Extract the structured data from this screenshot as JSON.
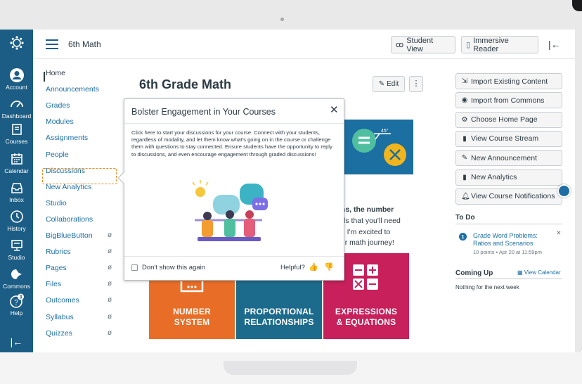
{
  "global_nav": {
    "items": [
      {
        "label": "Account",
        "icon": "account-icon"
      },
      {
        "label": "Dashboard",
        "icon": "dashboard-icon"
      },
      {
        "label": "Courses",
        "icon": "courses-icon"
      },
      {
        "label": "Calendar",
        "icon": "calendar-icon"
      },
      {
        "label": "Inbox",
        "icon": "inbox-icon"
      },
      {
        "label": "History",
        "icon": "history-icon"
      },
      {
        "label": "Studio",
        "icon": "studio-icon"
      },
      {
        "label": "Commons",
        "icon": "commons-icon"
      },
      {
        "label": "Help",
        "icon": "help-icon",
        "badge": "3"
      }
    ]
  },
  "header": {
    "course_name": "6th Math",
    "student_view": "Student View",
    "immersive_reader": "Immersive Reader"
  },
  "course_nav": {
    "items": [
      {
        "label": "Home",
        "active": true
      },
      {
        "label": "Announcements"
      },
      {
        "label": "Grades"
      },
      {
        "label": "Modules"
      },
      {
        "label": "Assignments"
      },
      {
        "label": "People"
      },
      {
        "label": "Discussions"
      },
      {
        "label": "New Analytics"
      },
      {
        "label": "Studio"
      },
      {
        "label": "Collaborations"
      },
      {
        "label": "BigBlueButton",
        "hidden": true
      },
      {
        "label": "Rubrics",
        "hidden": true
      },
      {
        "label": "Pages",
        "hidden": true
      },
      {
        "label": "Files",
        "hidden": true
      },
      {
        "label": "Outcomes",
        "hidden": true
      },
      {
        "label": "Syllabus",
        "hidden": true
      },
      {
        "label": "Quizzes",
        "hidden": true
      }
    ]
  },
  "main": {
    "title": "6th Grade Math",
    "edit": "Edit",
    "body_lines": [
      "rtions, the number",
      "t skills that you'll need",
      "hool.  I'm excited to",
      "f your math journey!"
    ],
    "tiles": [
      {
        "line1": "NUMBER",
        "line2": "SYSTEM",
        "color": "#e86d27"
      },
      {
        "line1": "PROPORTIONAL",
        "line2": "RELATIONSHIPS",
        "color": "#1c6a8c"
      },
      {
        "line1": "EXPRESSIONS",
        "line2": "& EQUATIONS",
        "color": "#c7205a"
      }
    ]
  },
  "popover": {
    "title": "Bolster Engagement in Your Courses",
    "body": "Click here to start your discussions for your course. Connect with your students, regardless of modality, and let them know what's going on in the course or challenge them with questions to stay connected. Ensure students have the opportunity to reply to discussions, and even encourage engagement through graded discussions!",
    "dont_show": "Don't show this again",
    "helpful": "Helpful?"
  },
  "sidebar": {
    "buttons": [
      {
        "label": "Import Existing Content",
        "icon": "import-icon"
      },
      {
        "label": "Import from Commons",
        "icon": "commons-icon"
      },
      {
        "label": "Choose Home Page",
        "icon": "home-page-icon"
      },
      {
        "label": "View Course Stream",
        "icon": "stream-icon"
      },
      {
        "label": "New Announcement",
        "icon": "announcement-icon"
      },
      {
        "label": "New Analytics",
        "icon": "analytics-icon"
      },
      {
        "label": "View Course Notifications",
        "icon": "bell-icon"
      }
    ],
    "todo": {
      "heading": "To Do",
      "item_title_1": "Grade Word Problems:",
      "item_title_2": "Ratios and Scenarios",
      "item_meta": "10 points • Apr 20 at 11:59pm",
      "count": "1"
    },
    "coming_up": {
      "heading": "Coming Up",
      "view_calendar": "View Calendar",
      "empty": "Nothing for the next week"
    }
  },
  "colors": {
    "nav_bg": "#1c5d85",
    "link": "#1c6ea4",
    "highlight": "#f08a1c"
  }
}
